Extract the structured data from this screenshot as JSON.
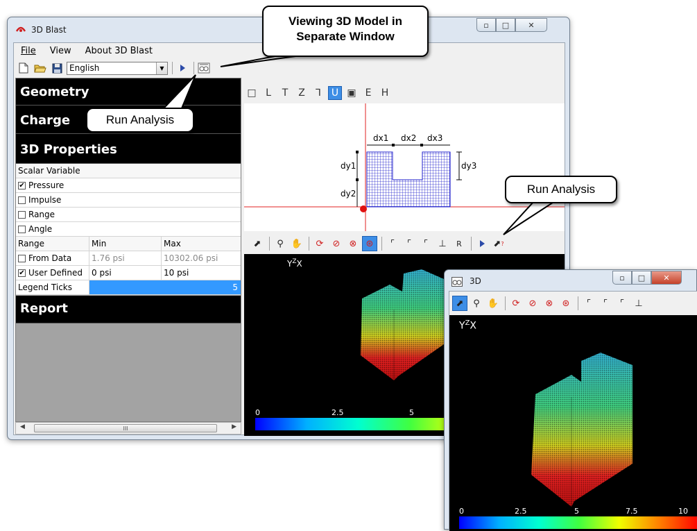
{
  "main_window": {
    "title": "3D Blast",
    "menu": [
      "File",
      "View",
      "About 3D Blast"
    ],
    "language": "English"
  },
  "shape_toolbar": [
    "□",
    "L",
    "T",
    "Z",
    "⅂",
    "U",
    "▣",
    "E",
    "H"
  ],
  "geometry_labels": {
    "dx1": "dx1",
    "dx2": "dx2",
    "dx3": "dx3",
    "dy1": "dy1",
    "dy2": "dy2",
    "dy3": "dy3"
  },
  "view_toolbar_extra": "R",
  "left_panel": {
    "geometry": "Geometry",
    "charge": "Charge",
    "properties": "3D Properties",
    "scalar_variable": "Scalar Variable",
    "variables": [
      {
        "label": "Pressure",
        "checked": true
      },
      {
        "label": "Impulse",
        "checked": false
      },
      {
        "label": "Range",
        "checked": false
      },
      {
        "label": "Angle",
        "checked": false
      }
    ],
    "range_table": {
      "headers": [
        "Range",
        "Min",
        "Max"
      ],
      "rows": [
        {
          "label": "From Data",
          "checked": false,
          "min": "1.76 psi",
          "max": "10302.06 psi"
        },
        {
          "label": "User Defined",
          "checked": true,
          "min": "0 psi",
          "max": "10 psi"
        }
      ]
    },
    "legend_ticks_label": "Legend Ticks",
    "legend_ticks_value": "5",
    "report": "Report",
    "scroll_thumb": "III"
  },
  "main_render": {
    "axis": {
      "y": "Y",
      "z": "Z",
      "x": "X"
    },
    "ticks": [
      "0",
      "2.5",
      "5"
    ]
  },
  "win3d": {
    "title": "3D",
    "axis": {
      "y": "Y",
      "z": "Z",
      "x": "X"
    },
    "ticks": [
      "0",
      "2.5",
      "5",
      "7.5",
      "10"
    ]
  },
  "callouts": {
    "separate_window": "Viewing 3D Model in\nSeparate Window",
    "run_analysis_left": "Run Analysis",
    "run_analysis_right": "Run Analysis"
  },
  "colors": {
    "selection": "#3399ff",
    "active_tool": "#3d8ee6",
    "mesh": "#2222cc",
    "axis_red": "#e02020"
  }
}
